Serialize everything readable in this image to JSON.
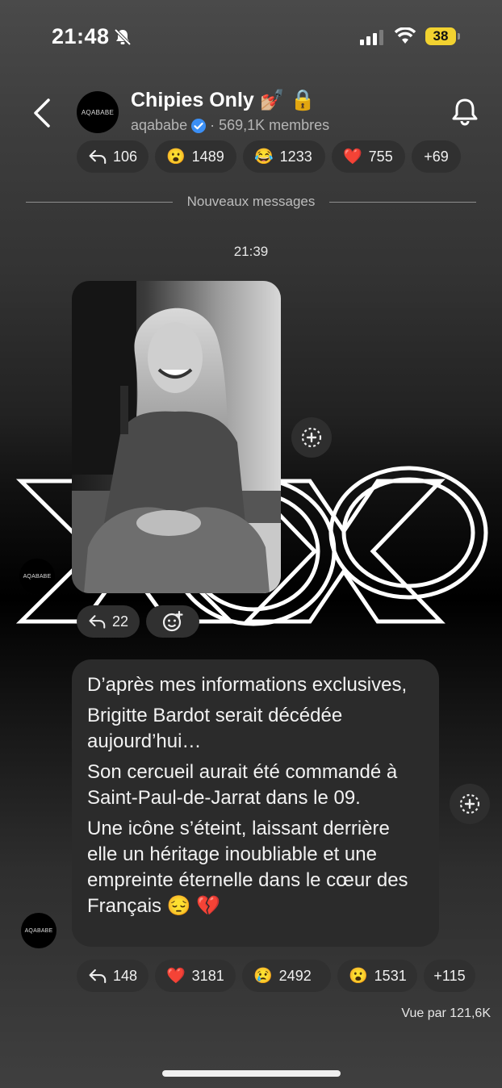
{
  "status_bar": {
    "time": "21:48",
    "battery": "38"
  },
  "channel": {
    "avatar_text": "AQABABE",
    "title": "Chipies Only 💅🏼 🔒",
    "handle": "aqababe",
    "members": "· 569,1K membres"
  },
  "top_reactions": [
    {
      "icon": "reply-icon",
      "count": "106"
    },
    {
      "emoji": "😮",
      "count": "1489"
    },
    {
      "emoji": "😂",
      "count": "1233"
    },
    {
      "emoji": "❤️",
      "count": "755"
    },
    {
      "label": "+69"
    }
  ],
  "new_messages_label": "Nouveaux messages",
  "message_time": "21:39",
  "photo_post": {
    "avatar_text": "AQABABE",
    "overlay_text": "XOXO",
    "replies": "22"
  },
  "text_post": {
    "avatar_text": "AQABABE",
    "paragraphs": [
      "D’après mes informations exclusives,",
      "Brigitte Bardot serait décédée aujourd’hui…",
      "Son cercueil aurait été commandé à Saint-Paul-de-Jarrat dans le 09.",
      "Une icône s’éteint, laissant derrière elle un héritage inoubliable et une empreinte éternelle dans le cœur des Français 😔 💔"
    ],
    "reactions": [
      {
        "icon": "reply-icon",
        "count": "148"
      },
      {
        "emoji": "❤️",
        "count": "3181"
      },
      {
        "emoji": "😢",
        "count": "2492"
      },
      {
        "emoji": "😮",
        "count": "1531"
      },
      {
        "label": "+115"
      }
    ],
    "views": "Vue par 121,6K"
  }
}
